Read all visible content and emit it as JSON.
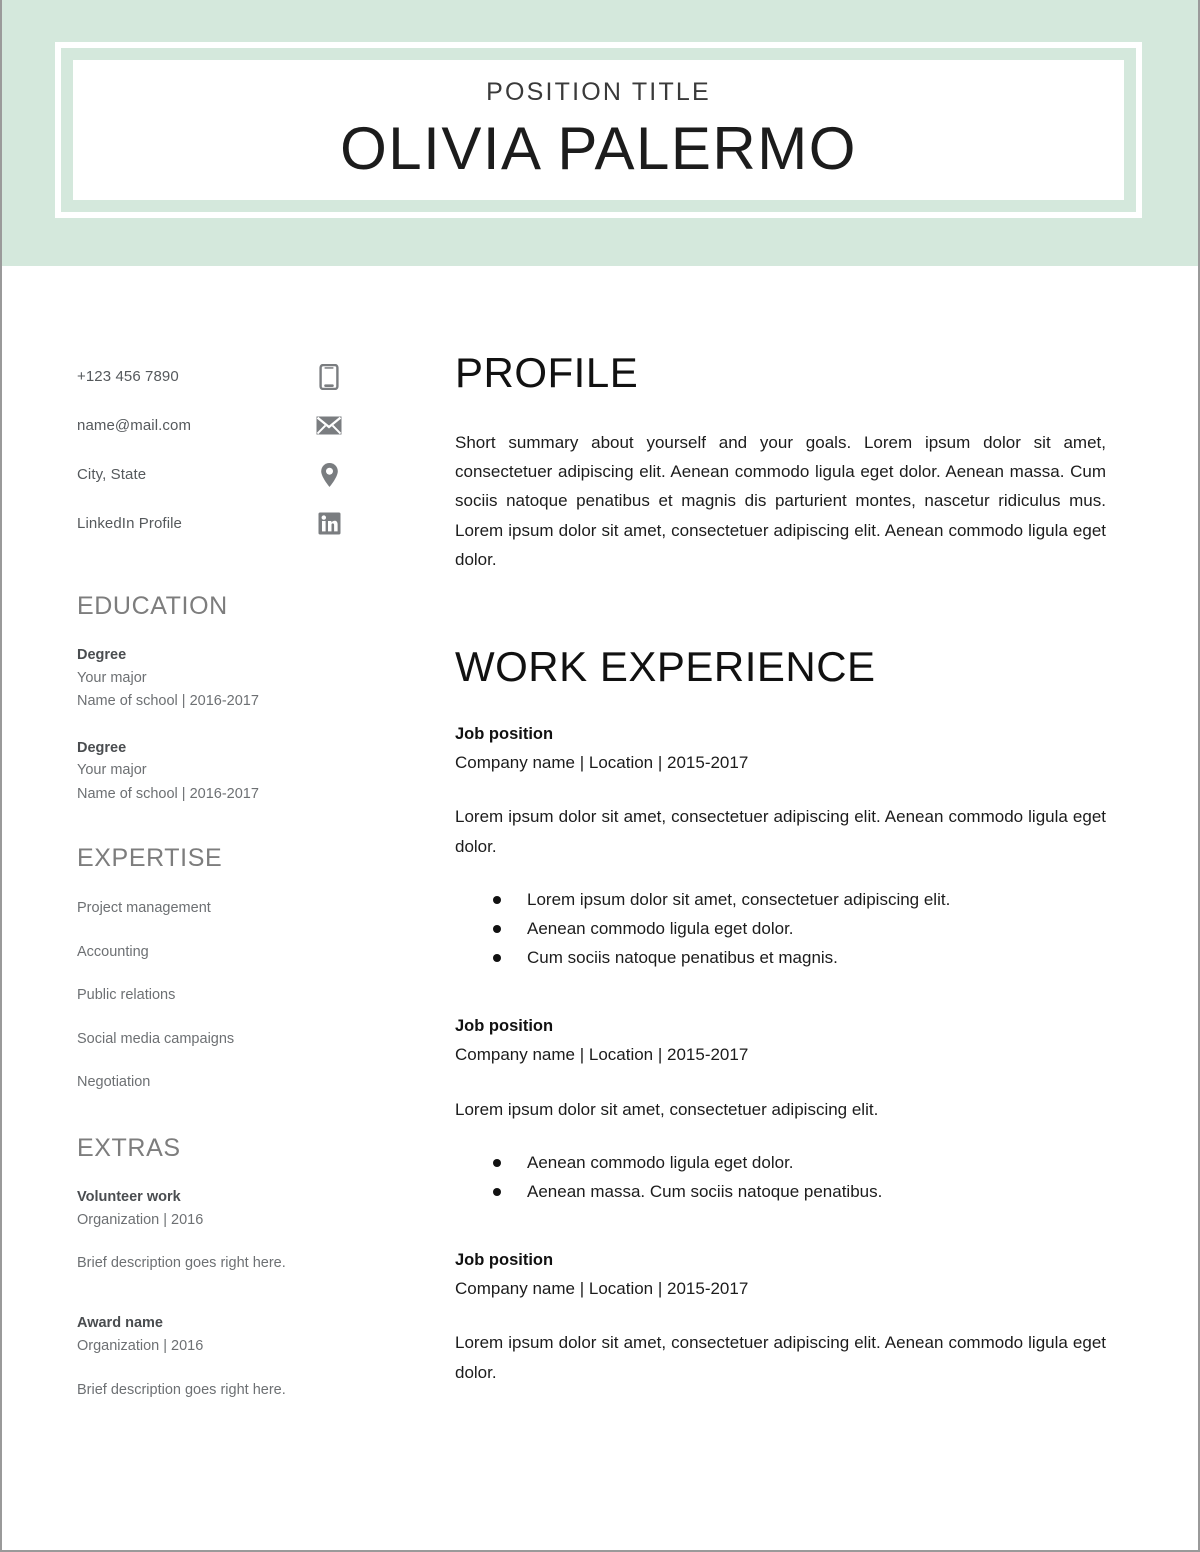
{
  "theme": {
    "accent_mint": "#d4e8dc",
    "heading_gray": "#7d7d7d",
    "body_text": "#1c1c1c",
    "sidebar_text": "#6d7073",
    "icon_gray": "#7a7d80"
  },
  "header": {
    "position_title": "POSITION TITLE",
    "name": "OLIVIA PALERMO"
  },
  "sidebar": {
    "contact": [
      {
        "icon": "smartphone-icon",
        "text": "+123 456 7890"
      },
      {
        "icon": "envelope-icon",
        "text": "name@mail.com"
      },
      {
        "icon": "location-pin-icon",
        "text": "City, State"
      },
      {
        "icon": "linkedin-icon",
        "text": "LinkedIn Profile"
      }
    ],
    "education": {
      "heading": "EDUCATION",
      "entries": [
        {
          "title": "Degree",
          "major": "Your major",
          "school": "Name of school | 2016-2017"
        },
        {
          "title": "Degree",
          "major": "Your major",
          "school": "Name of school | 2016-2017"
        }
      ]
    },
    "expertise": {
      "heading": "EXPERTISE",
      "items": [
        "Project management",
        "Accounting",
        "Public relations",
        "Social media campaigns",
        "Negotiation"
      ]
    },
    "extras": {
      "heading": "EXTRAS",
      "entries": [
        {
          "title": "Volunteer work",
          "org": "Organization | 2016",
          "description": "Brief description goes right here."
        },
        {
          "title": "Award name",
          "org": "Organization | 2016",
          "description": "Brief description goes right here."
        }
      ]
    }
  },
  "main": {
    "profile": {
      "heading": "PROFILE",
      "text": "Short summary about yourself and your goals. Lorem ipsum dolor sit amet, consectetuer adipiscing elit. Aenean commodo ligula eget dolor. Aenean massa. Cum sociis natoque penatibus et magnis dis parturient montes, nascetur ridiculus mus. Lorem ipsum dolor sit amet, consectetuer adipiscing elit. Aenean commodo ligula eget dolor."
    },
    "work": {
      "heading": "WORK EXPERIENCE",
      "jobs": [
        {
          "title": "Job position",
          "meta": "Company name | Location | 2015-2017",
          "description": "Lorem ipsum dolor sit amet, consectetuer adipiscing elit. Aenean commodo ligula eget dolor.",
          "bullets": [
            "Lorem ipsum dolor sit amet, consectetuer adipiscing elit.",
            "Aenean commodo ligula eget dolor.",
            "Cum sociis natoque penatibus et magnis."
          ]
        },
        {
          "title": "Job position",
          "meta": "Company name | Location | 2015-2017",
          "description": "Lorem ipsum dolor sit amet, consectetuer adipiscing elit.",
          "bullets": [
            "Aenean commodo ligula eget dolor.",
            "Aenean massa. Cum sociis natoque penatibus."
          ]
        },
        {
          "title": "Job position",
          "meta": "Company name | Location | 2015-2017",
          "description": "Lorem ipsum dolor sit amet, consectetuer adipiscing elit. Aenean commodo ligula eget dolor.",
          "bullets": []
        }
      ]
    }
  }
}
